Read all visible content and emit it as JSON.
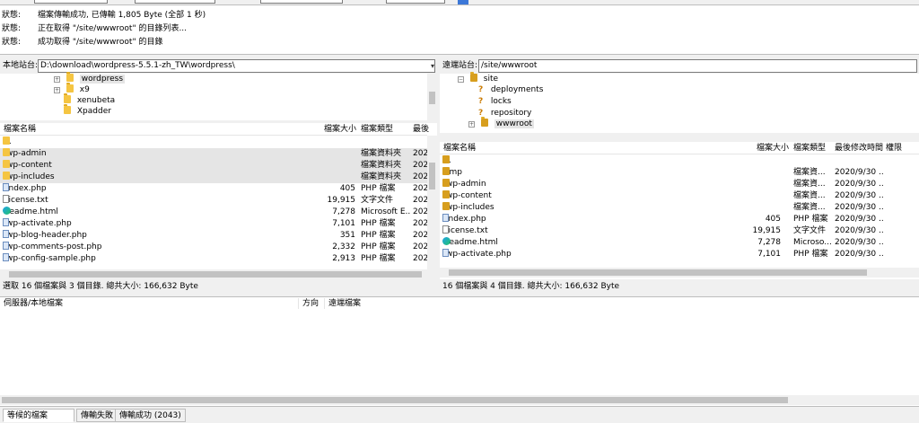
{
  "log": [
    {
      "k": "狀態:",
      "v": "檔案傳輸成功, 已傳輸 1,805 Byte (全部 1 秒)"
    },
    {
      "k": "狀態:",
      "v": "正在取得 \"/site/wwwroot\" 的目錄列表..."
    },
    {
      "k": "狀態:",
      "v": "成功取得 \"/site/wwwroot\" 的目錄"
    }
  ],
  "local": {
    "site_label": "本地站台:",
    "path": "D:\\download\\wordpress-5.5.1-zh_TW\\wordpress\\",
    "tree": [
      "wordpress",
      "x9",
      "xenubeta",
      "Xpadder"
    ],
    "columns": [
      "檔案名稱",
      "檔案大小",
      "檔案類型",
      "最後"
    ],
    "files": [
      {
        "name": "..",
        "size": "",
        "type": "",
        "date": "",
        "icon": "folder-icon",
        "sel": false
      },
      {
        "name": "wp-admin",
        "size": "",
        "type": "檔案資料夾",
        "date": "202",
        "icon": "folder-icon",
        "sel": true
      },
      {
        "name": "wp-content",
        "size": "",
        "type": "檔案資料夾",
        "date": "202",
        "icon": "folder-icon",
        "sel": true
      },
      {
        "name": "wp-includes",
        "size": "",
        "type": "檔案資料夾",
        "date": "202",
        "icon": "folder-icon",
        "sel": true
      },
      {
        "name": "index.php",
        "size": "405",
        "type": "PHP 檔案",
        "date": "202",
        "icon": "php-file-icon",
        "sel": false
      },
      {
        "name": "license.txt",
        "size": "19,915",
        "type": "文字文件",
        "date": "202",
        "icon": "text-file-icon",
        "sel": false
      },
      {
        "name": "readme.html",
        "size": "7,278",
        "type": "Microsoft E...",
        "date": "202",
        "icon": "edge-icon",
        "sel": false
      },
      {
        "name": "wp-activate.php",
        "size": "7,101",
        "type": "PHP 檔案",
        "date": "202",
        "icon": "php-file-icon",
        "sel": false
      },
      {
        "name": "wp-blog-header.php",
        "size": "351",
        "type": "PHP 檔案",
        "date": "202",
        "icon": "php-file-icon",
        "sel": false
      },
      {
        "name": "wp-comments-post.php",
        "size": "2,332",
        "type": "PHP 檔案",
        "date": "202",
        "icon": "php-file-icon",
        "sel": false
      },
      {
        "name": "wp-config-sample.php",
        "size": "2,913",
        "type": "PHP 檔案",
        "date": "202",
        "icon": "php-file-icon",
        "sel": false
      }
    ],
    "status": "選取 16 個檔案與 3 個目錄. 總共大小: 166,632 Byte"
  },
  "remote": {
    "site_label": "遠端站台:",
    "path": "/site/wwwroot",
    "tree": [
      "site",
      "deployments",
      "locks",
      "repository",
      "wwwroot"
    ],
    "columns": [
      "檔案名稱",
      "檔案大小",
      "檔案類型",
      "最後修改時間",
      "權限"
    ],
    "files": [
      {
        "name": "..",
        "size": "",
        "type": "",
        "date": "",
        "icon": "folder-icon"
      },
      {
        "name": "tmp",
        "size": "",
        "type": "檔案資...",
        "date": "2020/9/30 ...",
        "icon": "folder-icon"
      },
      {
        "name": "wp-admin",
        "size": "",
        "type": "檔案資...",
        "date": "2020/9/30 ...",
        "icon": "folder-icon"
      },
      {
        "name": "wp-content",
        "size": "",
        "type": "檔案資...",
        "date": "2020/9/30 ...",
        "icon": "folder-icon"
      },
      {
        "name": "wp-includes",
        "size": "",
        "type": "檔案資...",
        "date": "2020/9/30 ...",
        "icon": "folder-icon"
      },
      {
        "name": "index.php",
        "size": "405",
        "type": "PHP 檔案",
        "date": "2020/9/30 ...",
        "icon": "php-file-icon"
      },
      {
        "name": "license.txt",
        "size": "19,915",
        "type": "文字文件",
        "date": "2020/9/30 ...",
        "icon": "text-file-icon"
      },
      {
        "name": "readme.html",
        "size": "7,278",
        "type": "Microso...",
        "date": "2020/9/30 ...",
        "icon": "edge-icon"
      },
      {
        "name": "wp-activate.php",
        "size": "7,101",
        "type": "PHP 檔案",
        "date": "2020/9/30 ...",
        "icon": "php-file-icon"
      }
    ],
    "status": "16 個檔案與 4 個目錄. 總共大小: 166,632 Byte"
  },
  "queue": {
    "columns": [
      "伺服器/本地檔案",
      "方向",
      "遠端檔案"
    ]
  },
  "tabs": [
    "等候的檔案",
    "傳輸失敗",
    "傳輸成功 (2043)"
  ]
}
